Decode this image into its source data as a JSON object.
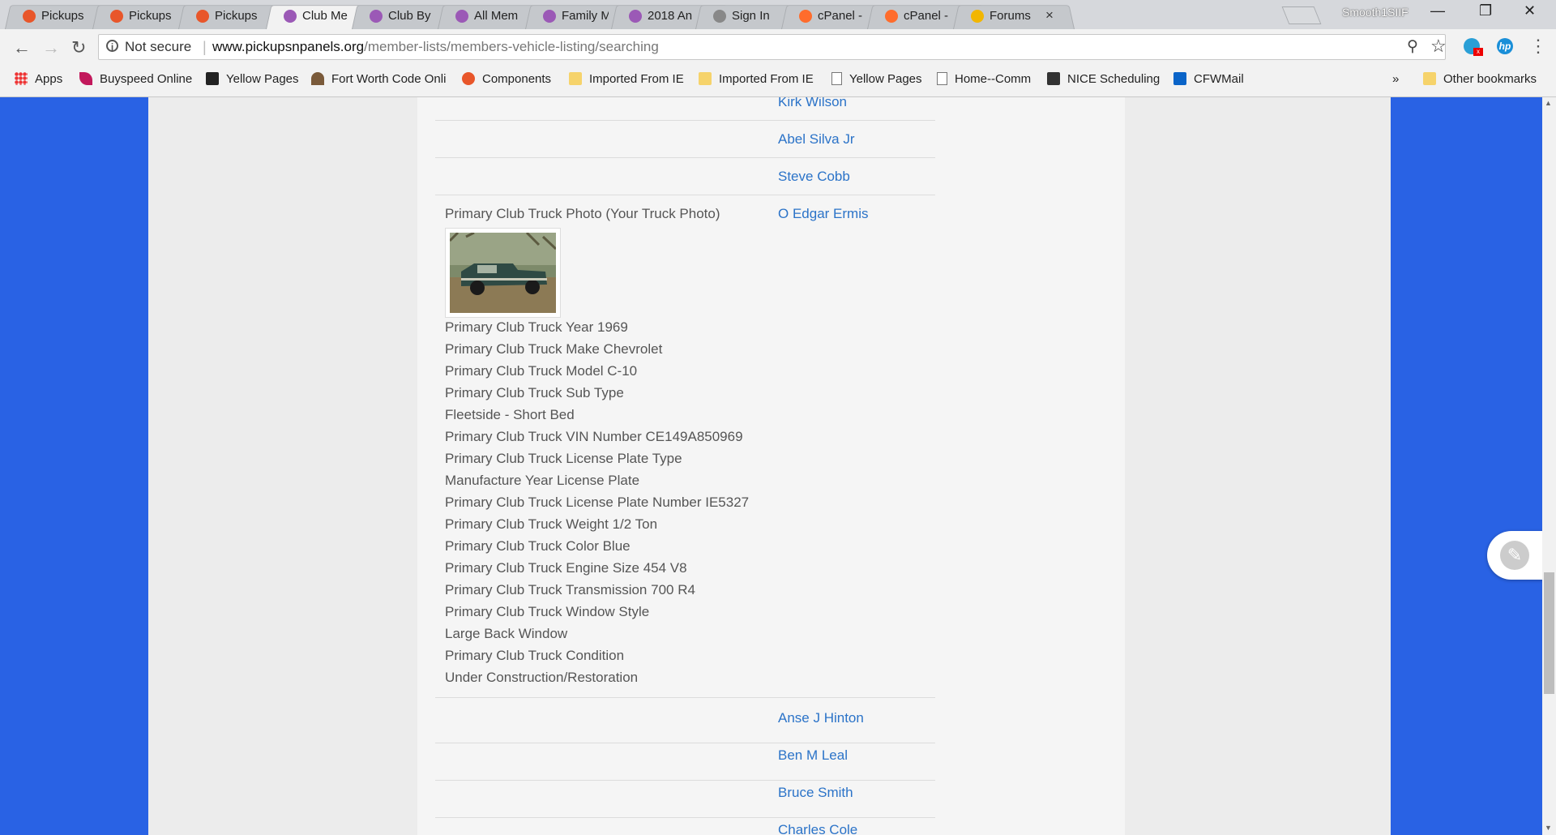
{
  "browser": {
    "tabs": [
      {
        "title": "Pickups",
        "icon": "joomla-icon",
        "color": "#e8562a"
      },
      {
        "title": "Pickups",
        "icon": "joomla-icon",
        "color": "#e8562a"
      },
      {
        "title": "Pickups",
        "icon": "joomla-icon",
        "color": "#e8562a"
      },
      {
        "title": "Club Me",
        "icon": "colorwheel-icon",
        "color": "#9b59b6",
        "active": true
      },
      {
        "title": "Club By",
        "icon": "colorwheel-icon",
        "color": "#9b59b6"
      },
      {
        "title": "All Mem",
        "icon": "colorwheel-icon",
        "color": "#9b59b6"
      },
      {
        "title": "Family M",
        "icon": "colorwheel-icon",
        "color": "#9b59b6"
      },
      {
        "title": "2018 An",
        "icon": "colorwheel-icon",
        "color": "#9b59b6"
      },
      {
        "title": "Sign In",
        "icon": "pointer-icon",
        "color": "#888888"
      },
      {
        "title": "cPanel -",
        "icon": "cpanel-icon",
        "color": "#ff6c2c"
      },
      {
        "title": "cPanel -",
        "icon": "cpanel-icon",
        "color": "#ff6c2c"
      },
      {
        "title": "Forums",
        "icon": "smiley-icon",
        "color": "#f2b600"
      }
    ],
    "close_glyph": "×",
    "profile_name": "Smooth1SIIF",
    "window": {
      "minimize": "—",
      "restore": "❐",
      "close": "✕"
    },
    "nav": {
      "back": "←",
      "forward": "→",
      "reload": "↻"
    },
    "security_label": "Not secure",
    "url_host": "www.pickupsnpanels.org",
    "url_path": "/member-lists/members-vehicle-listing/searching",
    "bookmarks": [
      {
        "label": "Apps",
        "icon": "apps-icon"
      },
      {
        "label": "Buyspeed Online",
        "icon": "feather-icon"
      },
      {
        "label": "Yellow Pages",
        "icon": "yp-icon"
      },
      {
        "label": "Fort Worth Code Onli",
        "icon": "library-icon"
      },
      {
        "label": "Components",
        "icon": "joomla-icon"
      },
      {
        "label": "Imported From IE",
        "icon": "folder-icon"
      },
      {
        "label": "Imported From IE",
        "icon": "folder-icon"
      },
      {
        "label": "Yellow Pages",
        "icon": "page-icon"
      },
      {
        "label": "Home--Comm",
        "icon": "page-icon"
      },
      {
        "label": "NICE Scheduling",
        "icon": "nice-icon"
      },
      {
        "label": "CFWMail",
        "icon": "outlook-icon"
      }
    ],
    "bookmarks_overflow": "»",
    "other_bookmarks": "Other bookmarks"
  },
  "listing": {
    "members_before": [
      "Kirk Wilson",
      "Abel Silva Jr",
      "Steve Cobb"
    ],
    "featured": {
      "member": "O Edgar Ermis",
      "photo_label": "Primary Club Truck Photo (Your Truck Photo)",
      "details": [
        "Primary Club Truck Year  1969",
        "Primary Club Truck Make  Chevrolet",
        "Primary Club Truck Model  C-10",
        "Primary Club Truck Sub Type",
        "Fleetside - Short Bed",
        "Primary Club Truck VIN Number  CE149A850969",
        "Primary Club Truck License Plate Type",
        "Manufacture Year License Plate",
        "Primary Club Truck License Plate Number  IE5327",
        "Primary Club Truck Weight  1/2 Ton",
        "Primary Club Truck Color  Blue",
        "Primary Club Truck Engine Size  454 V8",
        "Primary Club Truck Transmission  700 R4",
        "Primary Club Truck Window Style",
        "Large Back Window",
        "Primary Club Truck Condition",
        "Under Construction/Restoration"
      ]
    },
    "members_after": [
      "Anse J Hinton",
      "Ben M Leal",
      "Bruce Smith",
      "Charles Cole"
    ]
  },
  "colors": {
    "page_background": "#2962e4",
    "link": "#2b73c8",
    "text": "#555555"
  }
}
